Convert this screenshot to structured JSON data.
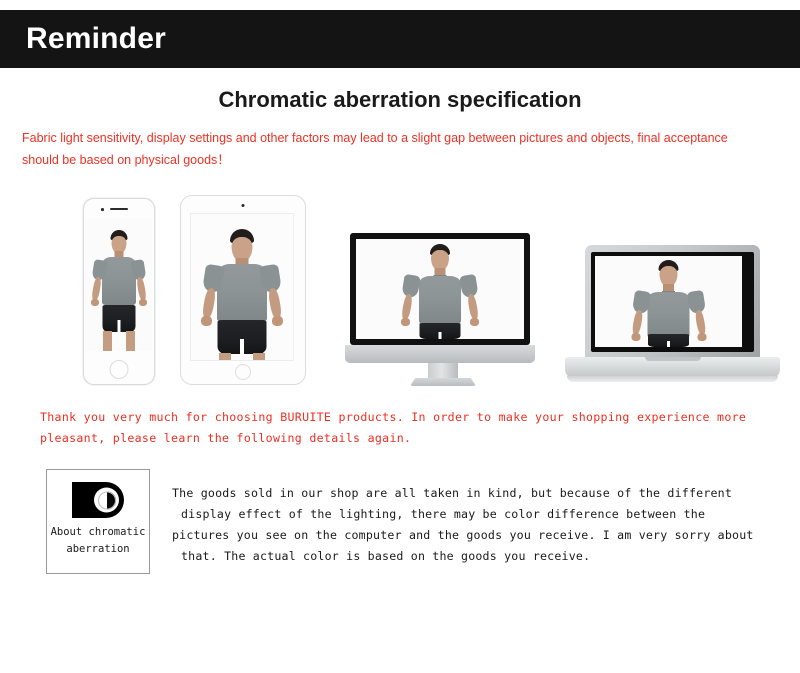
{
  "header": {
    "title": "Reminder",
    "background_color": "#141414",
    "text_color": "#ffffff"
  },
  "section": {
    "title": "Chromatic aberration specification",
    "intro_line_1": "Fabric light sensitivity, display settings and other factors may lead to a slight gap between pictures and objects, final",
    "intro_line_2": "acceptance should be based on physical goods！",
    "intro_color": "#ef3124"
  },
  "devices": [
    {
      "name": "smartphone",
      "label": "iPhone"
    },
    {
      "name": "tablet",
      "label": "iPad"
    },
    {
      "name": "desktop-monitor",
      "label": "iMac"
    },
    {
      "name": "laptop",
      "label": "MacBook"
    }
  ],
  "thanks": {
    "line_1": "Thank you very much for choosing BURUITE products. In order to make your shopping experience",
    "line_2": "more pleasant, please learn the following details again.",
    "color": "#ee2f22",
    "brand": "BURUITE"
  },
  "about": {
    "icon_name": "contrast-icon",
    "label_line_1": "About chromatic",
    "label_line_2": "aberration",
    "body_line_1": "The goods sold in our shop are all taken in kind, but because of the different",
    "body_line_2": "display effect of the lighting, there may be color difference between the",
    "body_line_3": "pictures you see on the computer and the goods you receive. I am very sorry about",
    "body_line_4": "that. The actual color is based on the goods you receive.",
    "body_color": "#1a1a1a",
    "border_color": "#9a9a9a"
  }
}
